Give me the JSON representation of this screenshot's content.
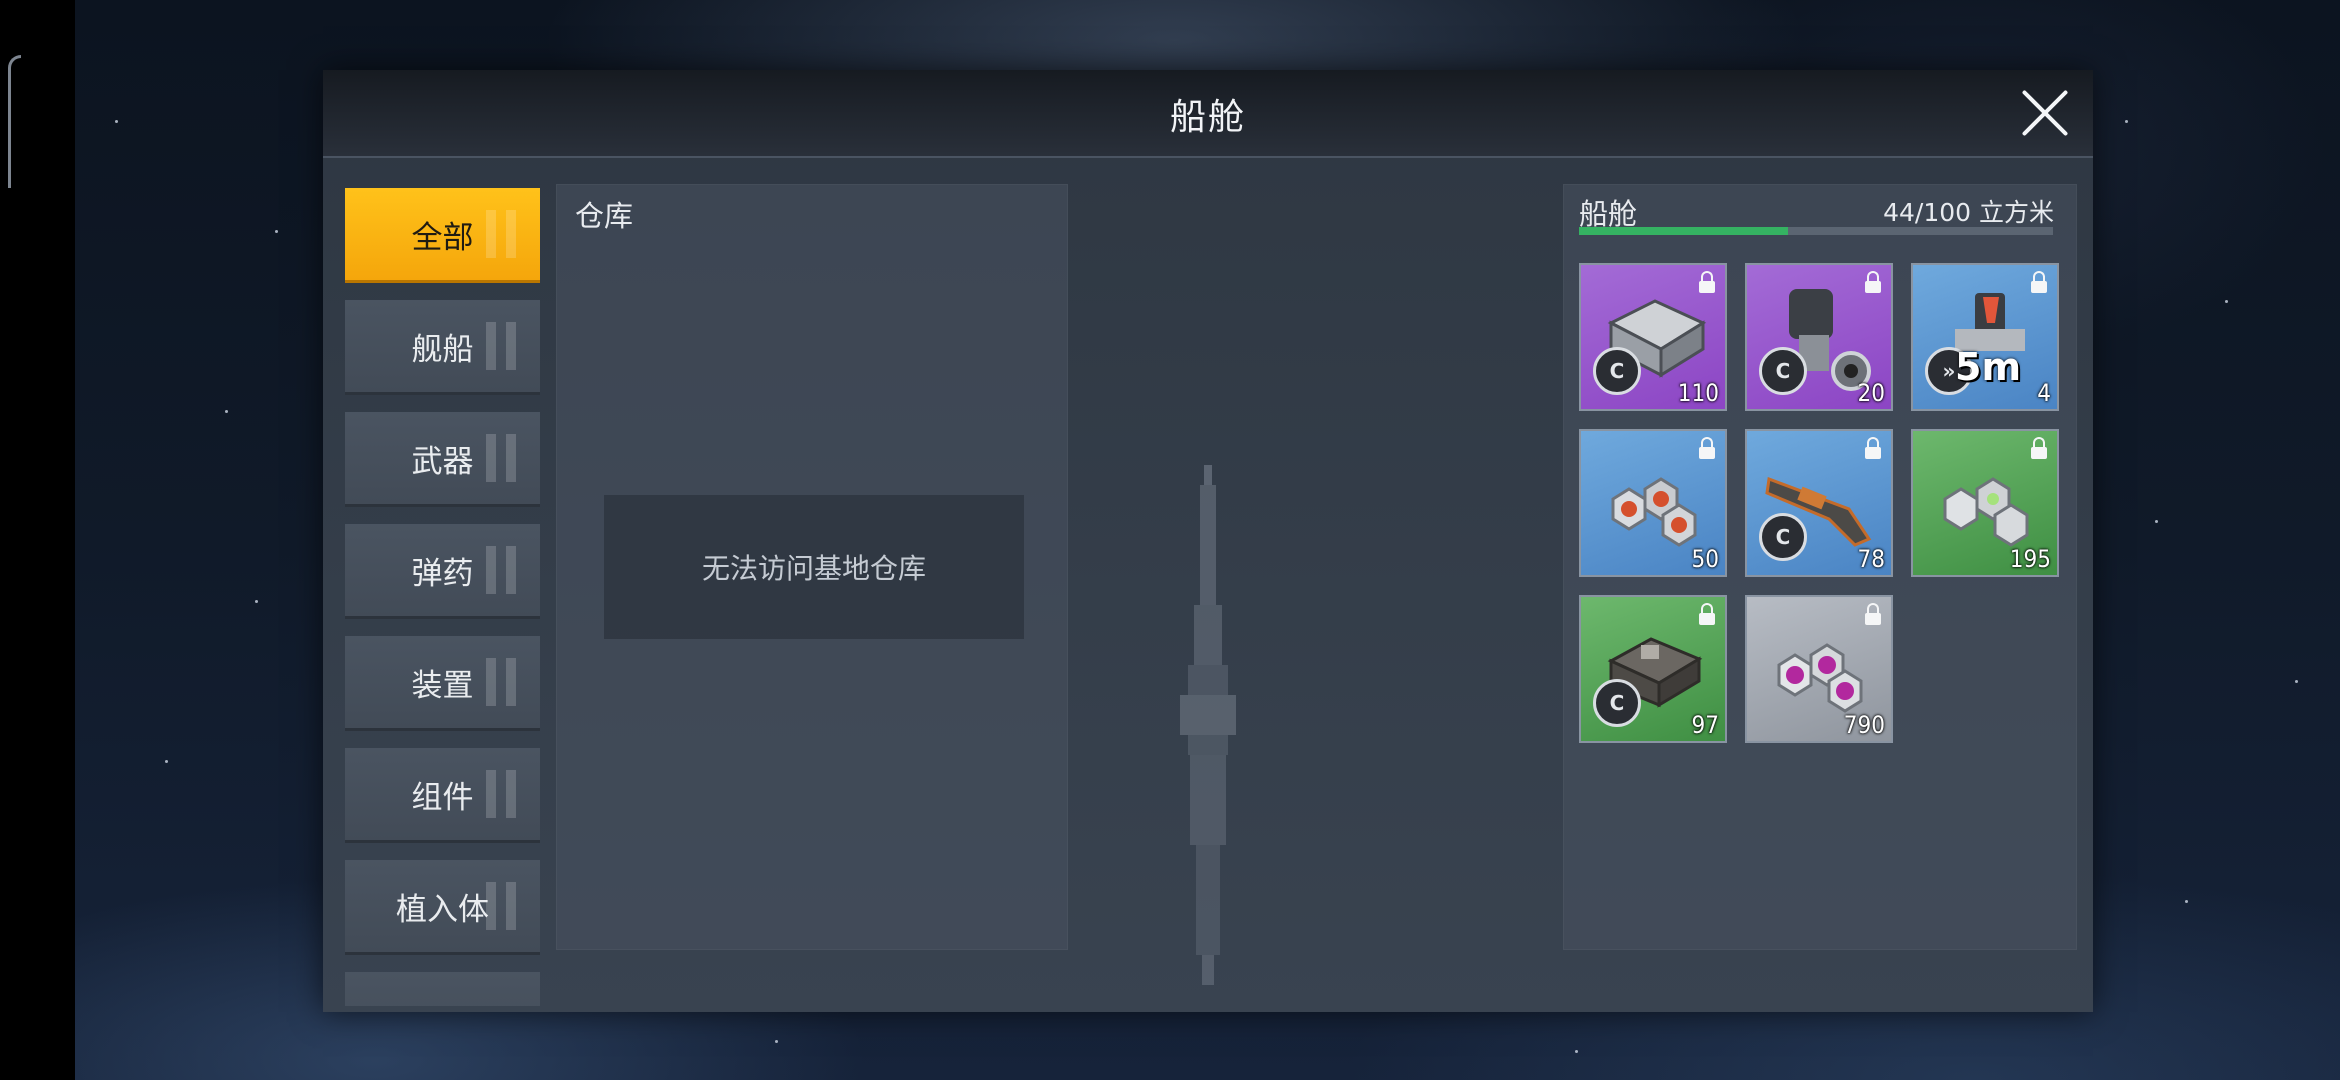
{
  "dialog": {
    "title": "船舱"
  },
  "categories": [
    {
      "label": "全部",
      "active": true
    },
    {
      "label": "舰船",
      "active": false
    },
    {
      "label": "武器",
      "active": false
    },
    {
      "label": "弹药",
      "active": false
    },
    {
      "label": "装置",
      "active": false
    },
    {
      "label": "组件",
      "active": false
    },
    {
      "label": "植入体",
      "active": false
    },
    {
      "label": "",
      "active": false
    }
  ],
  "warehouse": {
    "title": "仓库",
    "empty_message": "无法访问基地仓库"
  },
  "cabin": {
    "title": "船舱",
    "capacity_text": "44/100 立方米",
    "capacity_used": 44,
    "capacity_max": 100,
    "capacity_color": "#35b262",
    "items": [
      {
        "icon": "armor-plate-icon",
        "rarity": "purple",
        "quantity": "110",
        "locked": true,
        "badge": "C"
      },
      {
        "icon": "cannon-barrel-icon",
        "rarity": "purple",
        "quantity": "20",
        "locked": true,
        "badge": "C"
      },
      {
        "icon": "booster-module-icon",
        "rarity": "blue",
        "quantity": "4",
        "locked": true,
        "timer": "5m"
      },
      {
        "icon": "red-crystal-ore-icon",
        "rarity": "blue",
        "quantity": "50",
        "locked": true
      },
      {
        "icon": "rifle-weapon-icon",
        "rarity": "blue",
        "quantity": "78",
        "locked": true,
        "badge": "C"
      },
      {
        "icon": "green-crystal-ore-icon",
        "rarity": "green",
        "quantity": "195",
        "locked": true
      },
      {
        "icon": "engine-component-icon",
        "rarity": "green",
        "quantity": "97",
        "locked": true,
        "badge": "C"
      },
      {
        "icon": "purple-crystal-ore-icon",
        "rarity": "gray",
        "quantity": "790",
        "locked": true
      }
    ]
  }
}
